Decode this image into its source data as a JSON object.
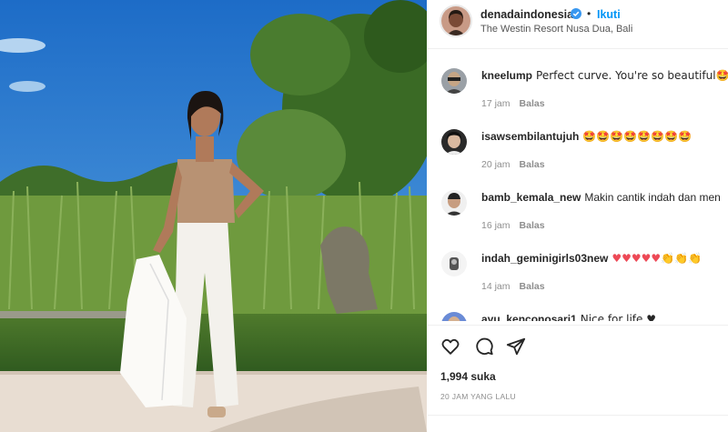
{
  "post": {
    "username": "denadaindonesia",
    "dot": "•",
    "follow_label": "Ikuti",
    "location": "The Westin Resort Nusa Dua, Bali"
  },
  "comments": [
    {
      "user": "kneelump",
      "text": "Perfect curve. You're so beautiful🤩",
      "time": "17 jam",
      "reply": "Balas"
    },
    {
      "user": "isawsembilantujuh",
      "text": "🤩🤩🤩🤩🤩🤩🤩🤩",
      "time": "20 jam",
      "reply": "Balas"
    },
    {
      "user": "bamb_kemala_new",
      "text": "Makin cantik indah dan men",
      "time": "16 jam",
      "reply": "Balas"
    },
    {
      "user": "indah_geminigirls03new",
      "text": "♥♥♥♥♥👏👏👏",
      "time": "14 jam",
      "reply": "Balas"
    },
    {
      "user": "ayu_kenconosari1",
      "text": "Nice for life ♥",
      "time": "",
      "reply": ""
    }
  ],
  "likes": "1,994 suka",
  "timestamp": "20 JAM YANG LALU",
  "colors": {
    "accent": "#0095f6",
    "heart": "#ed4956",
    "text": "#262626",
    "muted": "#8e8e8e"
  },
  "icons": [
    "heart-icon",
    "comment-icon",
    "share-icon",
    "verified-badge-icon"
  ]
}
